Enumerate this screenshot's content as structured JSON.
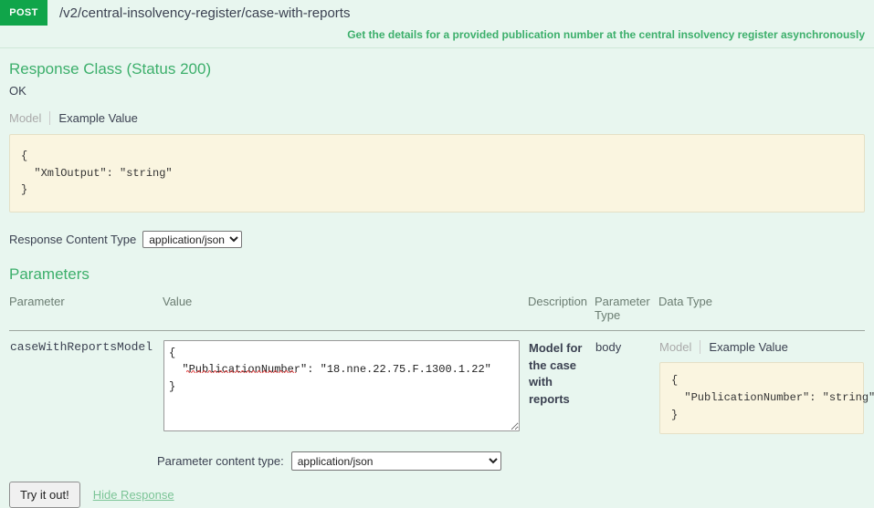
{
  "operation": {
    "method": "POST",
    "path": "/v2/central-insolvency-register/case-with-reports",
    "summary": "Get the details for a provided publication number at the central insolvency register asynchronously"
  },
  "response_class": {
    "title": "Response Class (Status 200)",
    "status_text": "OK",
    "tabs": {
      "model_label": "Model",
      "example_value_label": "Example Value"
    },
    "example_value": "{\n  \"XmlOutput\": \"string\"\n}"
  },
  "response_content_type": {
    "label": "Response Content Type",
    "selected": "application/json",
    "options": [
      "application/json"
    ]
  },
  "parameters": {
    "title": "Parameters",
    "columns": {
      "parameter": "Parameter",
      "value": "Value",
      "description": "Description",
      "parameter_type": "Parameter Type",
      "data_type": "Data Type"
    },
    "rows": [
      {
        "name": "caseWithReportsModel",
        "value": "{\n  \"PublicationNumber\": \"18.nne.22.75.F.1300.1.22\"\n}",
        "description": "Model for the case with reports",
        "parameter_type": "body",
        "data_type": {
          "model_label": "Model",
          "example_value_label": "Example Value",
          "example_value": "{\n  \"PublicationNumber\": \"string\"\n}"
        }
      }
    ]
  },
  "footer": {
    "content_type_label": "Parameter content type:",
    "content_type_selected": "application/json",
    "content_type_options": [
      "application/json"
    ],
    "try_it_label": "Try it out!",
    "hide_response_label": "Hide Response"
  },
  "colors": {
    "method_badge": "#10a54a",
    "accent_green": "#3caf6b",
    "page_background": "#e8f6ef",
    "code_background": "#faf5e0",
    "link_green": "#7bc496"
  }
}
